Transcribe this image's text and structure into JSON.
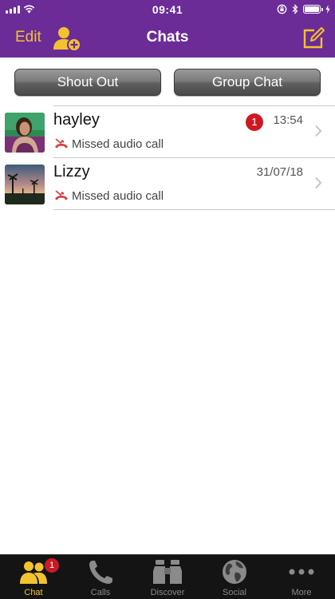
{
  "status_bar": {
    "time": "09:41",
    "battery_level": 0.9
  },
  "nav": {
    "edit_label": "Edit",
    "title": "Chats"
  },
  "actions": {
    "shout_out_label": "Shout Out",
    "group_chat_label": "Group Chat"
  },
  "chats": [
    {
      "name": "hayley",
      "unread_count": "1",
      "time": "13:54",
      "preview": "Missed audio call",
      "status_icon": "missed-call-icon"
    },
    {
      "name": "Lizzy",
      "unread_count": "",
      "time": "31/07/18",
      "preview": "Missed audio call",
      "status_icon": "missed-call-icon"
    }
  ],
  "tabbar": {
    "tabs": [
      {
        "label": "Chat",
        "icon": "chat-people-icon",
        "badge": "1",
        "active": true
      },
      {
        "label": "Calls",
        "icon": "phone-icon",
        "badge": "",
        "active": false
      },
      {
        "label": "Discover",
        "icon": "binoculars-icon",
        "badge": "",
        "active": false
      },
      {
        "label": "Social",
        "icon": "globe-icon",
        "badge": "",
        "active": false
      },
      {
        "label": "More",
        "icon": "more-dots-icon",
        "badge": "",
        "active": false
      }
    ]
  },
  "colors": {
    "brand_purple": "#6b2c97",
    "accent_gold": "#f2c32e",
    "badge_red": "#cc1a25",
    "missed_call_red": "#d83a3a",
    "tabbar_bg": "#141414"
  }
}
